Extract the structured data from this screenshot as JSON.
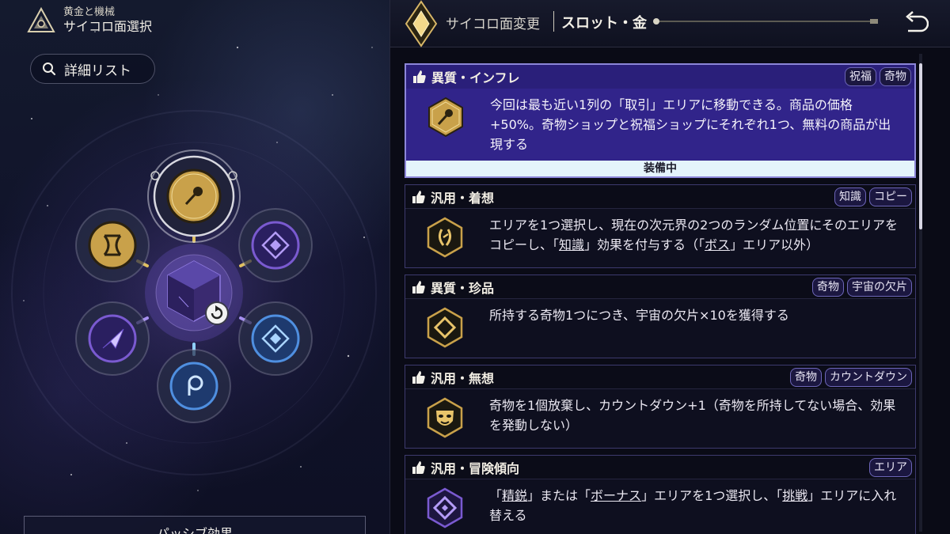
{
  "header": {
    "subtitle": "黄金と機械",
    "title": "サイコロ面選択",
    "detail_button": "詳細リスト",
    "logo_icon": "triangle-crest-icon"
  },
  "left_panel": {
    "passive_button": "パッシブ効果",
    "dice_faces": [
      {
        "position": "top",
        "icon": "orb-arrow-icon",
        "color": "#c9a14a",
        "selected": true
      },
      {
        "position": "upper-left",
        "icon": "hourglass-x-icon",
        "color": "#c9a14a"
      },
      {
        "position": "upper-right",
        "icon": "diamond-eye-icon",
        "color": "#7a5ad0"
      },
      {
        "position": "lower-left",
        "icon": "shard-arrow-icon",
        "color": "#7a5ad0"
      },
      {
        "position": "lower-right",
        "icon": "diamond-eye-icon",
        "color": "#4f8fe0"
      },
      {
        "position": "bottom",
        "icon": "p-rune-icon",
        "color": "#4f8fe0"
      }
    ],
    "center_icon": "dice-cube-icon",
    "reroll_icon": "rotate-icon"
  },
  "topbar": {
    "title": "サイコロ面変更",
    "slot": "スロット・金",
    "back_icon": "back-arrow-icon"
  },
  "cards": [
    {
      "name": "異質・インフレ",
      "tags": [
        "祝福",
        "奇物"
      ],
      "icon": "orb-arrow-icon",
      "desc": "今回は最も近い1列の「取引」エリアに移動できる。商品の価格+50%。奇物ショップと祝福ショップにそれぞれ1つ、無料の商品が出現する",
      "equipped": true,
      "equipped_label": "装備中"
    },
    {
      "name": "汎用・着想",
      "tags": [
        "知識",
        "コピー"
      ],
      "icon": "flame-rune-icon",
      "desc_parts": [
        "エリアを1つ選択し、現在の次元界の2つのランダム位置にそのエリアをコピーし、「",
        "知識",
        "」効果を付与する（「",
        "ボス",
        "」エリア以外）"
      ]
    },
    {
      "name": "異質・珍品",
      "tags": [
        "奇物",
        "宇宙の欠片"
      ],
      "icon": "diamond-icon",
      "desc": "所持する奇物1つにつき、宇宙の欠片×10を獲得する"
    },
    {
      "name": "汎用・無想",
      "tags": [
        "奇物",
        "カウントダウン"
      ],
      "icon": "mask-icon",
      "desc": "奇物を1個放棄し、カウントダウン+1（奇物を所持してない場合、効果を発動しない）"
    },
    {
      "name": "汎用・冒険傾向",
      "tags": [
        "エリア"
      ],
      "icon": "diamond-dot-icon",
      "desc_parts": [
        "「",
        "精鋭",
        "」または「",
        "ボーナス",
        "」エリアを1つ選択し、「",
        "挑戦",
        "」エリアに入れ替える"
      ]
    }
  ],
  "like_icon": "thumbs-up-icon"
}
